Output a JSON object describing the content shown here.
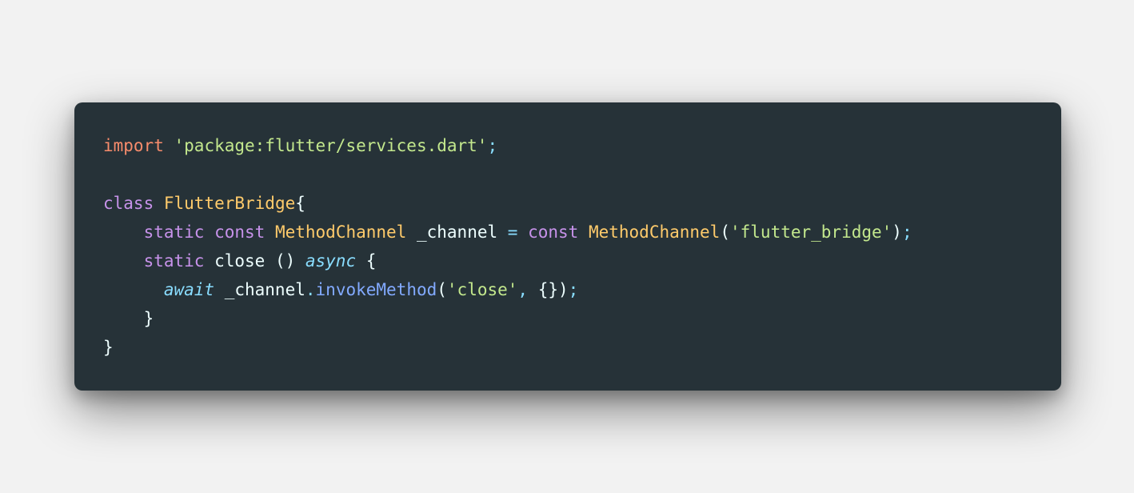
{
  "code": {
    "lines": [
      [
        {
          "t": "import",
          "c": "keyword"
        },
        {
          "t": " ",
          "c": "plain"
        },
        {
          "t": "'package:flutter/services.dart'",
          "c": "string"
        },
        {
          "t": ";",
          "c": "punct"
        }
      ],
      [],
      [
        {
          "t": "class",
          "c": "storage"
        },
        {
          "t": " ",
          "c": "plain"
        },
        {
          "t": "FlutterBridge",
          "c": "class"
        },
        {
          "t": "{",
          "c": "plain"
        }
      ],
      [
        {
          "t": "    ",
          "c": "plain"
        },
        {
          "t": "static",
          "c": "storage"
        },
        {
          "t": " ",
          "c": "plain"
        },
        {
          "t": "const",
          "c": "storage"
        },
        {
          "t": " ",
          "c": "plain"
        },
        {
          "t": "MethodChannel",
          "c": "class"
        },
        {
          "t": " _channel ",
          "c": "plain"
        },
        {
          "t": "=",
          "c": "punct"
        },
        {
          "t": " ",
          "c": "plain"
        },
        {
          "t": "const",
          "c": "storage"
        },
        {
          "t": " ",
          "c": "plain"
        },
        {
          "t": "MethodChannel",
          "c": "class"
        },
        {
          "t": "(",
          "c": "plain"
        },
        {
          "t": "'flutter_bridge'",
          "c": "string"
        },
        {
          "t": ")",
          "c": "plain"
        },
        {
          "t": ";",
          "c": "punct"
        }
      ],
      [
        {
          "t": "    ",
          "c": "plain"
        },
        {
          "t": "static",
          "c": "storage"
        },
        {
          "t": " close () ",
          "c": "plain"
        },
        {
          "t": "async",
          "c": "italic"
        },
        {
          "t": " {",
          "c": "plain"
        }
      ],
      [
        {
          "t": "      ",
          "c": "plain"
        },
        {
          "t": "await",
          "c": "italic"
        },
        {
          "t": " _channel",
          "c": "plain"
        },
        {
          "t": ".",
          "c": "punct"
        },
        {
          "t": "invokeMethod",
          "c": "func"
        },
        {
          "t": "(",
          "c": "plain"
        },
        {
          "t": "'close'",
          "c": "string"
        },
        {
          "t": ", ",
          "c": "punct"
        },
        {
          "t": "{})",
          "c": "plain"
        },
        {
          "t": ";",
          "c": "punct"
        }
      ],
      [
        {
          "t": "    }",
          "c": "plain"
        }
      ],
      [
        {
          "t": "}",
          "c": "plain"
        }
      ]
    ]
  }
}
